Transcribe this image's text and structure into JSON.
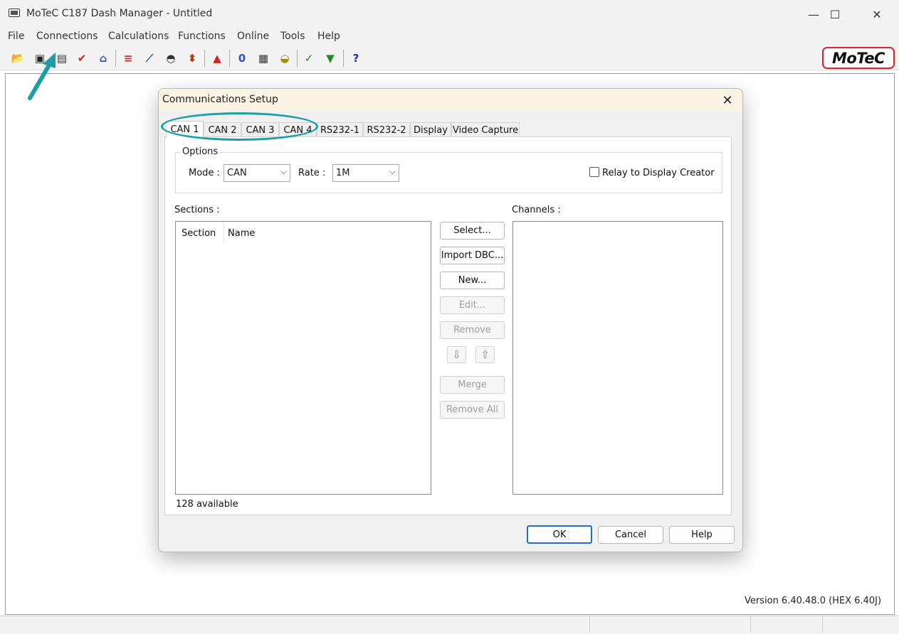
{
  "window": {
    "title": "MoTeC C187 Dash Manager - Untitled",
    "minimize_glyph": "—",
    "maximize_glyph": "☐",
    "close_glyph": "✕"
  },
  "menu": {
    "items": [
      "File",
      "Connections",
      "Calculations",
      "Functions",
      "Online",
      "Tools",
      "Help"
    ]
  },
  "toolbar": {
    "buttons": [
      {
        "icon": "open-folder-icon",
        "glyph": "📂",
        "color": "#c89a1a"
      },
      {
        "icon": "save-icon",
        "glyph": "▣",
        "color": "#222222"
      },
      {
        "icon": "config-icon",
        "glyph": "▤",
        "color": "#333333"
      },
      {
        "icon": "check-icon",
        "glyph": "✔",
        "color": "#d42020"
      },
      {
        "icon": "book-icon",
        "glyph": "⌂",
        "color": "#3355aa"
      },
      {
        "icon": "channels-icon",
        "glyph": "≡",
        "color": "#d42020"
      },
      {
        "icon": "chart-icon",
        "glyph": "⟋",
        "color": "#2a56c6"
      },
      {
        "icon": "gauge-icon",
        "glyph": "◓",
        "color": "#333333"
      },
      {
        "icon": "traffic-light-icon",
        "glyph": "⬍",
        "color": "#bb3311"
      },
      {
        "icon": "upload-icon",
        "glyph": "▲",
        "color": "#d42020"
      },
      {
        "icon": "zero-icon",
        "glyph": "0",
        "color": "#2a56c6"
      },
      {
        "icon": "table-icon",
        "glyph": "▦",
        "color": "#333333"
      },
      {
        "icon": "dash-icon",
        "glyph": "◒",
        "color": "#aa8800"
      },
      {
        "icon": "download-graph-icon",
        "glyph": "✓",
        "color": "#1f8a2a"
      },
      {
        "icon": "download-icon",
        "glyph": "▼",
        "color": "#1f8a2a"
      },
      {
        "icon": "help-icon",
        "glyph": "?",
        "color": "#2030b0"
      }
    ]
  },
  "logo": {
    "text": "MoTeC"
  },
  "status": {
    "version": "Version 6.40.48.0    (HEX 6.40J)"
  },
  "dialog": {
    "title": "Communications Setup",
    "close_glyph": "✕",
    "tabs": [
      "CAN 1",
      "CAN 2",
      "CAN 3",
      "CAN 4",
      "RS232-1",
      "RS232-2",
      "Display",
      "Video Capture"
    ],
    "active_tab": "CAN 1",
    "options": {
      "group_label": "Options",
      "mode_label": "Mode :",
      "mode_value": "CAN",
      "rate_label": "Rate :",
      "rate_value": "1M",
      "relay_label": "Relay to Display Creator",
      "relay_checked": false
    },
    "sections": {
      "label": "Sections :",
      "columns": [
        "Section",
        "Name"
      ],
      "available": "128 available"
    },
    "channels": {
      "label": "Channels :"
    },
    "actions": {
      "select": "Select...",
      "import_dbc": "Import DBC...",
      "new": "New...",
      "edit": "Edit...",
      "remove": "Remove",
      "move_down_glyph": "⇩",
      "move_up_glyph": "⇧",
      "merge": "Merge",
      "remove_all": "Remove All"
    },
    "footer": {
      "ok": "OK",
      "cancel": "Cancel",
      "help": "Help"
    }
  },
  "annotation": {
    "color": "#1a9fa8"
  }
}
